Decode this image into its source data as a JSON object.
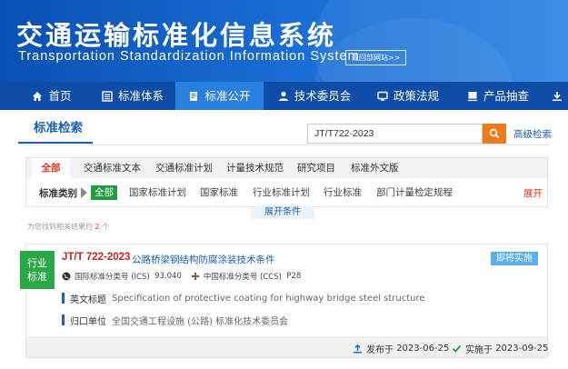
{
  "header": {
    "title_cn": "交通运输标准化信息系统",
    "title_en": "Transportation Standardization Information System",
    "back_label": "返回部网站>>"
  },
  "nav": {
    "items": [
      {
        "label": "首页",
        "icon": "home-icon"
      },
      {
        "label": "标准体系",
        "icon": "list-icon"
      },
      {
        "label": "标准公开",
        "icon": "document-icon"
      },
      {
        "label": "技术委员会",
        "icon": "user-icon"
      },
      {
        "label": "政策法规",
        "icon": "monitor-icon"
      },
      {
        "label": "产品抽查",
        "icon": "report-icon"
      }
    ],
    "active_index": 2
  },
  "search": {
    "tab_label": "标准检索",
    "query": "JT/T722-2023",
    "advanced_label": "高级检索"
  },
  "filter": {
    "categories": [
      "全部",
      "交通标准文本",
      "交通标准计划",
      "计量技术规范",
      "研究项目",
      "标准外文版"
    ],
    "active_category": 0,
    "type_label": "标准类别",
    "types": [
      "全部",
      "国家标准计划",
      "国家标准",
      "行业标准计划",
      "行业标准",
      "部门计量检定规程"
    ],
    "active_type": 0,
    "expand_label": "展开",
    "expand_conditions_label": "展开条件"
  },
  "results": {
    "count_prefix": "为您找到相关结果约",
    "count": "2",
    "count_suffix": "个"
  },
  "result_card": {
    "badge_line1": "行业",
    "badge_line2": "标准",
    "code": "JT/T 722-2023",
    "title": "公路桥梁钢结构防腐涂装技术条件",
    "status": "即将实施",
    "ics_label": "国际标准分类号 (ICS)",
    "ics_value": "93.040",
    "ccs_label": "中国标准分类号 (CCS)",
    "ccs_value": "P28",
    "en_title_label": "英文标题",
    "en_title_value": "Specification of protective coating for highway bridge steel structure",
    "owner_label": "归口单位",
    "owner_value": "全国交通工程设施 (公路) 标准化技术委员会",
    "published_label": "发布于",
    "published_date": "2023-06-25",
    "effective_label": "实施于",
    "effective_date": "2023-09-25"
  },
  "colors": {
    "brand_blue": "#0d4da8",
    "accent_orange": "#ee7a1c",
    "active_green": "#1f9d3e",
    "alert_red": "#e0331b"
  }
}
